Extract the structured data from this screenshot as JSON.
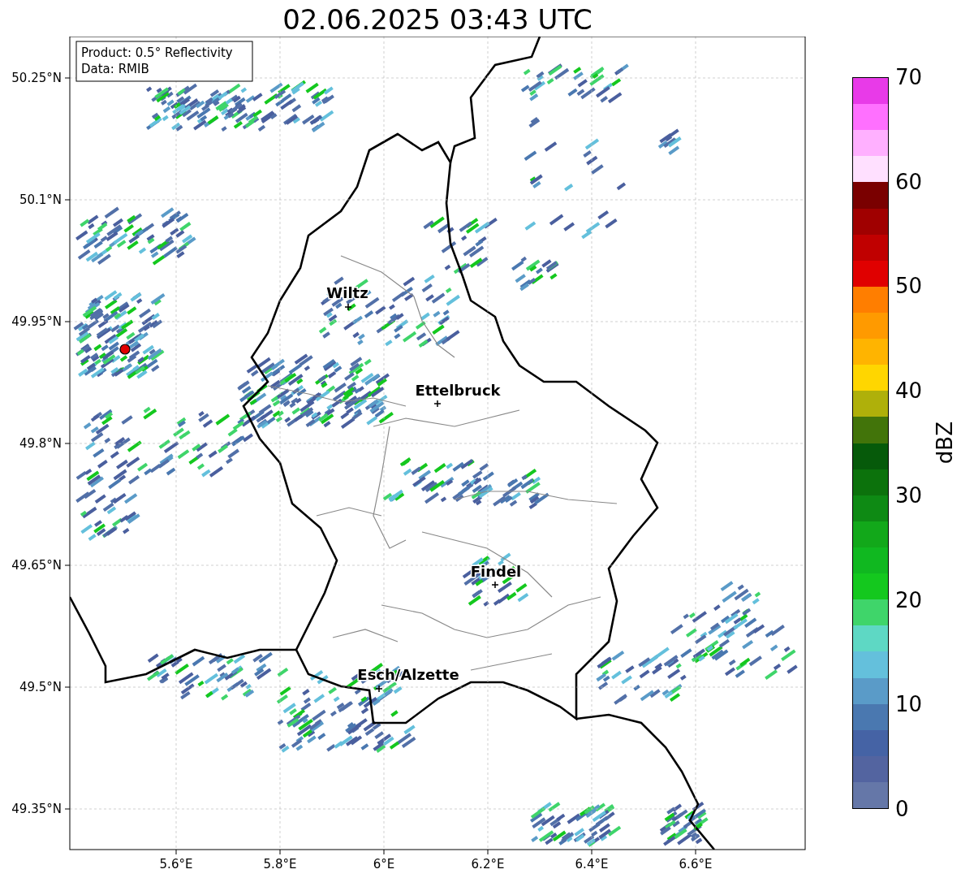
{
  "title": "02.06.2025 03:43 UTC",
  "info_box": [
    "Product: 0.5° Reflectivity",
    "Data: RMIB"
  ],
  "y_labels": [
    "50.25°N",
    "50.1°N",
    "49.95°N",
    "49.8°N",
    "49.65°N",
    "49.5°N",
    "49.35°N"
  ],
  "x_labels": [
    "5.6°E",
    "5.8°E",
    "6°E",
    "6.2°E",
    "6.4°E",
    "6.6°E"
  ],
  "cities": [
    {
      "name": "Wiltz"
    },
    {
      "name": "Ettelbruck"
    },
    {
      "name": "Findel"
    },
    {
      "name": "Esch/Alzette"
    }
  ],
  "colorbar": {
    "label": "dBZ",
    "ticks": [
      "70",
      "60",
      "50",
      "40",
      "30",
      "20",
      "10",
      "0"
    ],
    "bands": [
      {
        "color": "#e83ae8"
      },
      {
        "color": "#ff70ff"
      },
      {
        "color": "#ffb0ff"
      },
      {
        "color": "#ffe0ff"
      },
      {
        "color": "#7a0000"
      },
      {
        "color": "#a00000"
      },
      {
        "color": "#c00000"
      },
      {
        "color": "#e00000"
      },
      {
        "color": "#ff7e00"
      },
      {
        "color": "#ff9a00"
      },
      {
        "color": "#ffb400"
      },
      {
        "color": "#ffd600"
      },
      {
        "color": "#afb00a"
      },
      {
        "color": "#42740a"
      },
      {
        "color": "#065a0a"
      },
      {
        "color": "#0c720c"
      },
      {
        "color": "#0e8a14"
      },
      {
        "color": "#12a81a"
      },
      {
        "color": "#10b820"
      },
      {
        "color": "#14c81e"
      },
      {
        "color": "#3fd56a"
      },
      {
        "color": "#5ed8c4"
      },
      {
        "color": "#64c0dc"
      },
      {
        "color": "#5a9bc8"
      },
      {
        "color": "#4a78b0"
      },
      {
        "color": "#4563a5"
      },
      {
        "color": "#5364a0"
      },
      {
        "color": "#6577a8"
      }
    ]
  }
}
